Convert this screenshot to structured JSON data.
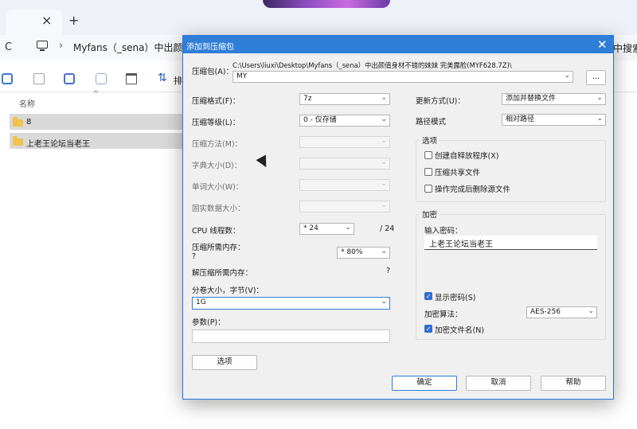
{
  "explorer": {
    "tab_close": "×",
    "tab_add": "+",
    "refresh": "C",
    "breadcrumb_sep": "›",
    "breadcrumb": "Myfans（_sena）中出颜值身",
    "breadcrumb_right": "中搜索",
    "sort_label": "排",
    "column_name": "名称",
    "column_caret": "^",
    "files": [
      {
        "name": "8"
      },
      {
        "name": "上老王论坛当老王"
      }
    ]
  },
  "dialog": {
    "title": "添加到压缩包",
    "close": "✕",
    "archive_label": "压缩包(A)：",
    "archive_path": "C:\\Users\\liuxi\\Desktop\\Myfans（_sena）中出颜值身材不错的妹妹 完美露脸(MYF628.7Z)\\",
    "archive_name": "MY",
    "browse_label": "...",
    "left": {
      "format_label": "压缩格式(F)：",
      "format_value": "7z",
      "level_label": "压缩等级(L)：",
      "level_value": "0 - 仅存储",
      "method_label": "压缩方法(M)：",
      "dict_label": "字典大小(D)：",
      "word_label": "单词大小(W)：",
      "solid_label": "固实数据大小：",
      "threads_label": "CPU 线程数：",
      "threads_value": "* 24",
      "threads_total": "/ 24",
      "mem_label": "压缩所需内存：",
      "mem_value": "?",
      "mem_pct": "* 80%",
      "decomp_label": "解压缩所需内存：",
      "decomp_value": "?",
      "split_label": "分卷大小，字节(V)：",
      "split_value": "1G",
      "params_label": "参数(P)：",
      "params_value": "",
      "options_button": "选项"
    },
    "right": {
      "update_label": "更新方式(U)：",
      "update_value": "添加并替换文件",
      "path_label": "路径模式",
      "path_value": "相对路径",
      "options_group": "选项",
      "opt_sfx": "创建自释放程序(X)",
      "opt_shared": "压缩共享文件",
      "opt_delete": "操作完成后删除源文件",
      "encrypt_group": "加密",
      "password_label": "输入密码：",
      "password_value": "上老王论坛当老王",
      "show_password": "显示密码(S)",
      "enc_method_label": "加密算法：",
      "enc_method_value": "AES-256",
      "enc_names": "加密文件名(N)"
    },
    "buttons": {
      "ok": "确定",
      "cancel": "取消",
      "help": "帮助"
    },
    "caret_glyph": "⌄",
    "check_glyph": "✓"
  }
}
